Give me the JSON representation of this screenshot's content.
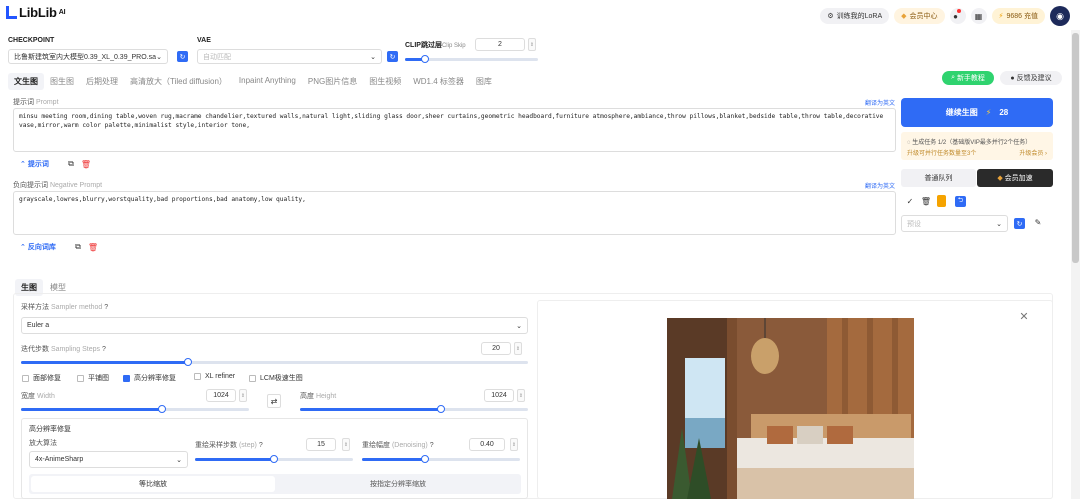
{
  "header": {
    "logo": "LibLib",
    "logo_suffix": "AI",
    "train_lora": "训练我的LoRA",
    "vip_center": "会员中心",
    "credits": "9686 充值"
  },
  "checkpoint": {
    "label": "CHECKPOINT",
    "value": "比鲁斯建筑室内大模型0.39_XL_0.39_PRO.safe"
  },
  "vae": {
    "label": "VAE",
    "placeholder": "自动匹配"
  },
  "clip": {
    "label": "CLIP跳过层",
    "label_en": "Clip Skip",
    "value": "2",
    "fraction": 0.15
  },
  "tabs": [
    "文生图",
    "图生图",
    "后期处理",
    "高清放大（Tiled diffusion）",
    "Inpaint Anything",
    "PNG图片信息",
    "图生视频",
    "WD1.4 标签器",
    "图库"
  ],
  "tab_active": 0,
  "tutorial_btn": "新手教程",
  "feedback_btn": "反馈及建议",
  "prompt": {
    "label": "提示词",
    "label_en": "Prompt",
    "translate": "翻译为英文",
    "text": "minsu meeting room,dining table,woven rug,macrame chandelier,textured walls,natural light,sliding glass door,sheer curtains,geometric headboard,furniture atmosphere,ambiance,throw pillows,blanket,bedside table,throw table,decorative vase,mirror,warm color palette,minimalist style,interior tone,",
    "wordbook": "提示词"
  },
  "negative": {
    "label": "负向提示词",
    "label_en": "Negative Prompt",
    "translate": "翻译为英文",
    "text": "grayscale,lowres,blurry,worstquality,bad proportions,bad anatomy,low quality,",
    "wordbook": "反向词库"
  },
  "generate": {
    "label": "继续生图",
    "cost": "28"
  },
  "notice": {
    "line1": "生成任务 1/2（基础版VIP最多并行2个任务）",
    "line2": "升级可并行任务数量至3个",
    "upgrade": "升级会员 ›"
  },
  "queue": {
    "normal": "普通队列",
    "vip": "会员加速"
  },
  "preset": {
    "placeholder": "预设"
  },
  "subtabs": [
    "生图",
    "模型"
  ],
  "sampler": {
    "label": "采样方法",
    "label_en": "Sampler method",
    "value": "Euler a"
  },
  "steps": {
    "label": "迭代步数",
    "label_en": "Sampling Steps",
    "value": "20",
    "fraction": 0.33
  },
  "checkboxes": [
    {
      "label": "面部修复",
      "on": false
    },
    {
      "label": "平铺图",
      "on": false
    },
    {
      "label": "高分辨率修复",
      "on": true
    },
    {
      "label": "XL refiner",
      "on": false
    },
    {
      "label": "LCM极速生图",
      "on": false
    }
  ],
  "width": {
    "label": "宽度",
    "label_en": "Width",
    "value": "1024",
    "fraction": 0.62
  },
  "height": {
    "label": "高度",
    "label_en": "Height",
    "value": "1024",
    "fraction": 0.62
  },
  "hires": {
    "title": "高分辨率修复",
    "upscaler_label": "放大算法",
    "upscaler_value": "4x-AnimeSharp",
    "steps_label": "重绘采样步数",
    "steps_label_en": "(step)",
    "steps_value": "15",
    "steps_fraction": 0.5,
    "denoise_label": "重绘幅度",
    "denoise_label_en": "(Denoising)",
    "denoise_value": "0.40",
    "denoise_fraction": 0.4,
    "scale_tab": "等比缩放",
    "res_tab": "按指定分辨率缩放"
  },
  "colors": {
    "accent": "#2f6bf5",
    "vip_gold": "#e8a33a",
    "green": "#2fd36f"
  }
}
